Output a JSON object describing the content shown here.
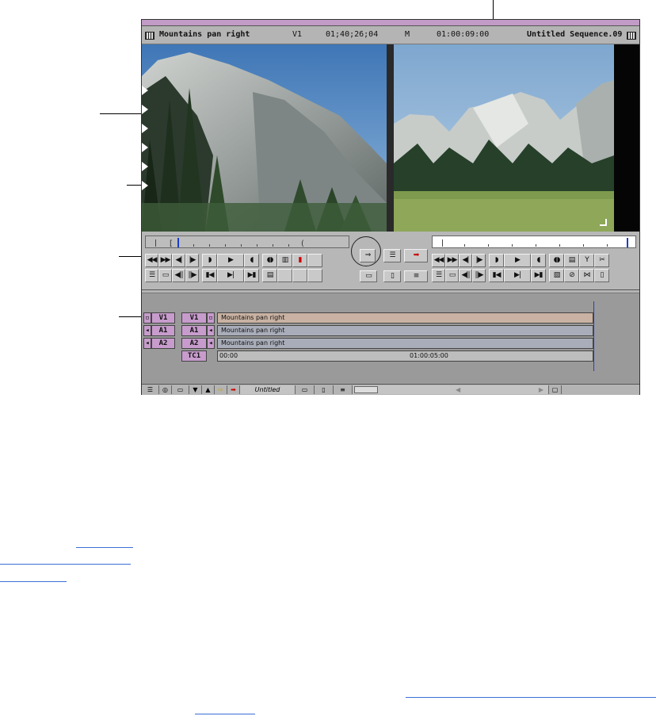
{
  "window": {
    "clip_name": "Mountains pan right",
    "track": "V1",
    "source_timecode": "01;40;26;04",
    "mark": "M",
    "record_timecode": "01:00:09:00",
    "sequence_name": "Untitled Sequence.09"
  },
  "timeline": {
    "source_tracks": [
      "V1",
      "A1",
      "A2"
    ],
    "record_tracks": [
      "V1",
      "A1",
      "A2",
      "TC1"
    ],
    "clips": [
      "Mountains pan right",
      "Mountains pan right",
      "Mountains pan right"
    ],
    "tc_start": "00:00",
    "tc_mid": "01:00:05:00"
  },
  "bottom_bar": {
    "bin_name": "Untitled"
  },
  "icons": {
    "splice": "splice-in-arrow-icon",
    "overwrite": "overwrite-arrow-icon",
    "play": "play-icon",
    "mark_in": "mark-in-icon",
    "mark_out": "mark-out-icon"
  },
  "colors": {
    "title_bar": "#c29bc6",
    "track_pad": "#c79ccc",
    "clip": "#a9adb9",
    "selected_clip": "#c9b2a3"
  }
}
